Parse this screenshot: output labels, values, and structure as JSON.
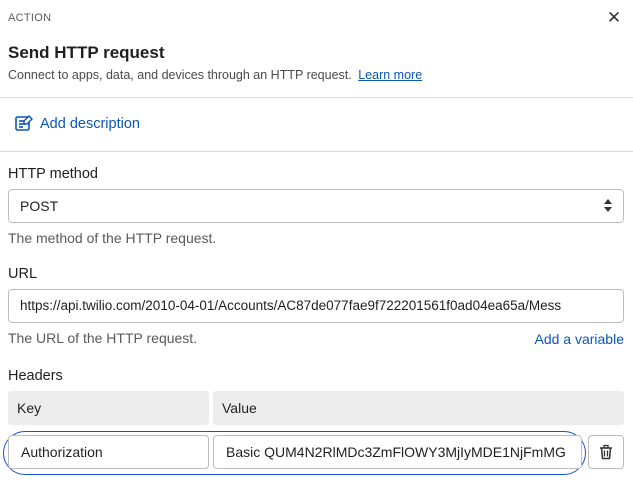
{
  "header": {
    "eyebrow": "ACTION",
    "title": "Send HTTP request",
    "subtitle": "Connect to apps, data, and devices through an HTTP request.",
    "learn_more": "Learn more"
  },
  "description": {
    "add_label": "Add description"
  },
  "method": {
    "label": "HTTP method",
    "value": "POST",
    "help": "The method of the HTTP request."
  },
  "url": {
    "label": "URL",
    "value": "https://api.twilio.com/2010-04-01/Accounts/AC87de077fae9f722201561f0ad04ea65a/Mess",
    "help": "The URL of the HTTP request.",
    "add_variable": "Add a variable"
  },
  "headers": {
    "label": "Headers",
    "columns": [
      "Key",
      "Value"
    ],
    "rows": [
      {
        "key": "Authorization",
        "value": "Basic QUM4N2RlMDc3ZmFlOWY3MjIyMDE1NjFmMG"
      }
    ]
  },
  "icons": {
    "close": "close-icon",
    "description": "notes-icon",
    "delete": "trash-icon",
    "select": "chevron-updown-icon"
  },
  "colors": {
    "link": "#0b57b3",
    "focus": "#1a4fd6"
  }
}
